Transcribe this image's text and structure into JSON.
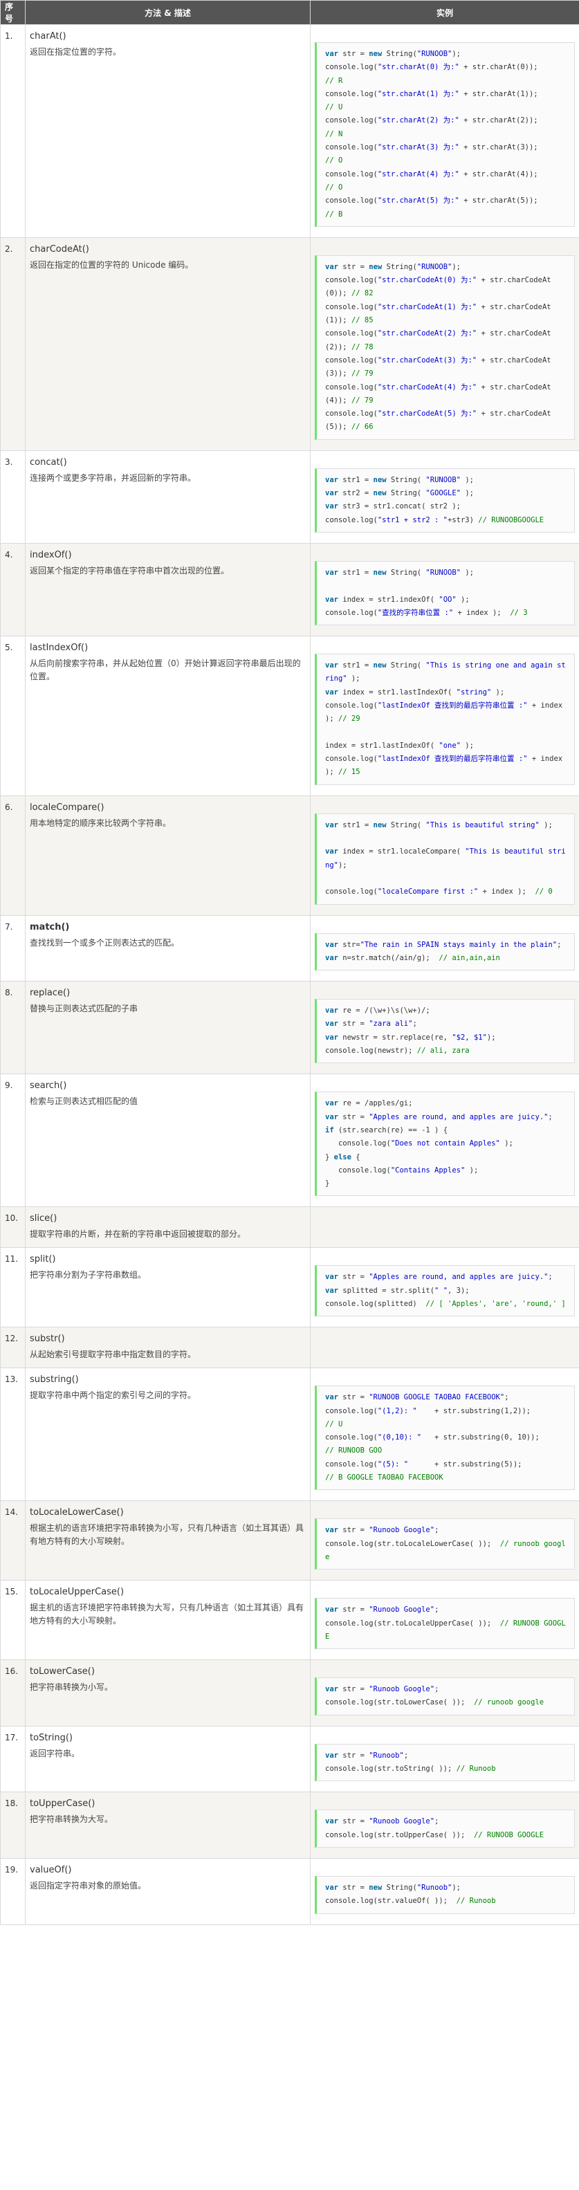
{
  "header": {
    "col_no": "序号",
    "col_method": "方法 & 描述",
    "col_example": "实例"
  },
  "rows": [
    {
      "no": "1.",
      "name": "charAt()",
      "desc": "返回在指定位置的字符。",
      "code": "var str = new String(\"RUNOOB\");\nconsole.log(\"str.charAt(0) 为:\" + str.charAt(0));\n// R\nconsole.log(\"str.charAt(1) 为:\" + str.charAt(1));\n// U\nconsole.log(\"str.charAt(2) 为:\" + str.charAt(2));\n// N\nconsole.log(\"str.charAt(3) 为:\" + str.charAt(3));\n// O\nconsole.log(\"str.charAt(4) 为:\" + str.charAt(4));\n// O\nconsole.log(\"str.charAt(5) 为:\" + str.charAt(5));\n// B"
    },
    {
      "no": "2.",
      "name": "charCodeAt()",
      "desc": "返回在指定的位置的字符的 Unicode 编码。",
      "code": "var str = new String(\"RUNOOB\");\nconsole.log(\"str.charCodeAt(0) 为:\" + str.charCodeAt(0)); // 82\nconsole.log(\"str.charCodeAt(1) 为:\" + str.charCodeAt(1)); // 85\nconsole.log(\"str.charCodeAt(2) 为:\" + str.charCodeAt(2)); // 78\nconsole.log(\"str.charCodeAt(3) 为:\" + str.charCodeAt(3)); // 79\nconsole.log(\"str.charCodeAt(4) 为:\" + str.charCodeAt(4)); // 79\nconsole.log(\"str.charCodeAt(5) 为:\" + str.charCodeAt(5)); // 66"
    },
    {
      "no": "3.",
      "name": "concat()",
      "desc": "连接两个或更多字符串，并返回新的字符串。",
      "code": "var str1 = new String( \"RUNOOB\" );\nvar str2 = new String( \"GOOGLE\" );\nvar str3 = str1.concat( str2 );\nconsole.log(\"str1 + str2 : \"+str3) // RUNOOBGOOGLE"
    },
    {
      "no": "4.",
      "name": "indexOf()",
      "desc": "返回某个指定的字符串值在字符串中首次出现的位置。",
      "code": "var str1 = new String( \"RUNOOB\" );\n\nvar index = str1.indexOf( \"OO\" );\nconsole.log(\"查找的字符串位置 :\" + index );  // 3"
    },
    {
      "no": "5.",
      "name": "lastIndexOf()",
      "desc": "从后向前搜索字符串，并从起始位置（0）开始计算返回字符串最后出现的位置。",
      "code": "var str1 = new String( \"This is string one and again string\" );\nvar index = str1.lastIndexOf( \"string\" );\nconsole.log(\"lastIndexOf 查找到的最后字符串位置 :\" + index ); // 29\n\nindex = str1.lastIndexOf( \"one\" );\nconsole.log(\"lastIndexOf 查找到的最后字符串位置 :\" + index ); // 15"
    },
    {
      "no": "6.",
      "name": "localeCompare()",
      "desc": "用本地特定的顺序来比较两个字符串。",
      "code": "var str1 = new String( \"This is beautiful string\" );\n\nvar index = str1.localeCompare( \"This is beautiful string\");\n\nconsole.log(\"localeCompare first :\" + index );  // 0"
    },
    {
      "no": "7.",
      "name": "match()",
      "bold": true,
      "desc": "查找找到一个或多个正则表达式的匹配。",
      "code": "var str=\"The rain in SPAIN stays mainly in the plain\";\nvar n=str.match(/ain/g);  // ain,ain,ain"
    },
    {
      "no": "8.",
      "name": "replace()",
      "desc": "替换与正则表达式匹配的子串",
      "code": "var re = /(\\w+)\\s(\\w+)/;\nvar str = \"zara ali\";\nvar newstr = str.replace(re, \"$2, $1\");\nconsole.log(newstr); // ali, zara"
    },
    {
      "no": "9.",
      "name": "search()",
      "desc": "检索与正则表达式相匹配的值",
      "code": "var re = /apples/gi;\nvar str = \"Apples are round, and apples are juicy.\";\nif (str.search(re) == -1 ) {\n   console.log(\"Does not contain Apples\" );\n} else {\n   console.log(\"Contains Apples\" );\n}"
    },
    {
      "no": "10.",
      "name": "slice()",
      "desc": "提取字符串的片断，并在新的字符串中返回被提取的部分。",
      "code": ""
    },
    {
      "no": "11.",
      "name": "split()",
      "desc": "把字符串分割为子字符串数组。",
      "code": "var str = \"Apples are round, and apples are juicy.\";\nvar splitted = str.split(\" \", 3);\nconsole.log(splitted)  // [ 'Apples', 'are', 'round,' ]"
    },
    {
      "no": "12.",
      "name": "substr()",
      "desc": "从起始索引号提取字符串中指定数目的字符。",
      "code": ""
    },
    {
      "no": "13.",
      "name": "substring()",
      "desc": "提取字符串中两个指定的索引号之间的字符。",
      "code": "var str = \"RUNOOB GOOGLE TAOBAO FACEBOOK\";\nconsole.log(\"(1,2): \"    + str.substring(1,2));\n// U\nconsole.log(\"(0,10): \"   + str.substring(0, 10));\n// RUNOOB GOO\nconsole.log(\"(5): \"      + str.substring(5));\n// B GOOGLE TAOBAO FACEBOOK"
    },
    {
      "no": "14.",
      "name": "toLocaleLowerCase()",
      "desc": "根据主机的语言环境把字符串转换为小写，只有几种语言（如土耳其语）具有地方特有的大小写映射。",
      "code": "var str = \"Runoob Google\";\nconsole.log(str.toLocaleLowerCase( ));  // runoob google"
    },
    {
      "no": "15.",
      "name": "toLocaleUpperCase()",
      "desc": "据主机的语言环境把字符串转换为大写，只有几种语言（如土耳其语）具有地方特有的大小写映射。",
      "code": "var str = \"Runoob Google\";\nconsole.log(str.toLocaleUpperCase( ));  // RUNOOB GOOGLE"
    },
    {
      "no": "16.",
      "name": "toLowerCase()",
      "desc": "把字符串转换为小写。",
      "code": "var str = \"Runoob Google\";\nconsole.log(str.toLowerCase( ));  // runoob google"
    },
    {
      "no": "17.",
      "name": "toString()",
      "desc": "返回字符串。",
      "code": "var str = \"Runoob\";\nconsole.log(str.toString( )); // Runoob"
    },
    {
      "no": "18.",
      "name": "toUpperCase()",
      "desc": "把字符串转换为大写。",
      "code": "var str = \"Runoob Google\";\nconsole.log(str.toUpperCase( ));  // RUNOOB GOOGLE"
    },
    {
      "no": "19.",
      "name": "valueOf()",
      "desc": "返回指定字符串对象的原始值。",
      "code": "var str = new String(\"Runoob\");\nconsole.log(str.valueOf( ));  // Runoob"
    }
  ]
}
